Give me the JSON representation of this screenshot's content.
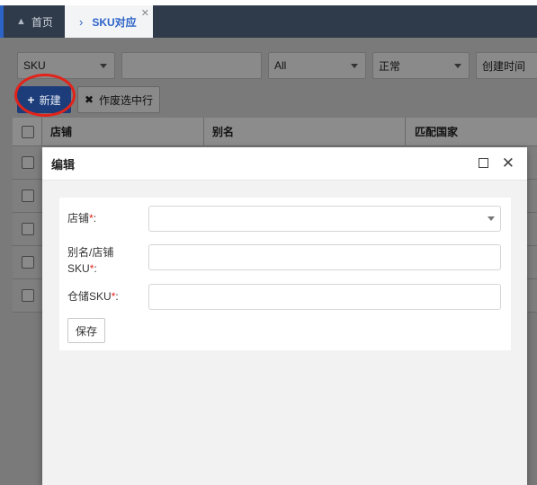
{
  "tabs": {
    "home_label": "首页",
    "active_label": "SKU对应"
  },
  "filters": {
    "field_select": "SKU",
    "search_value": "",
    "status_all": "All",
    "status_normal": "正常",
    "date_field": "创建时间"
  },
  "toolbar": {
    "new_label": "新建",
    "discard_label": "作废选中行"
  },
  "table": {
    "columns": [
      "店铺",
      "别名",
      "匹配国家"
    ],
    "row_count": 5
  },
  "modal": {
    "title": "编辑",
    "fields": {
      "shop_label": "店铺",
      "alias_label_line1": "别名/店铺",
      "alias_label_line2": "SKU",
      "warehouse_label": "仓储SKU",
      "required_mark": "*"
    },
    "save_label": "保存"
  },
  "colors": {
    "accent": "#2d63c8",
    "required": "#e2231a",
    "annotation": "#e2231a"
  }
}
